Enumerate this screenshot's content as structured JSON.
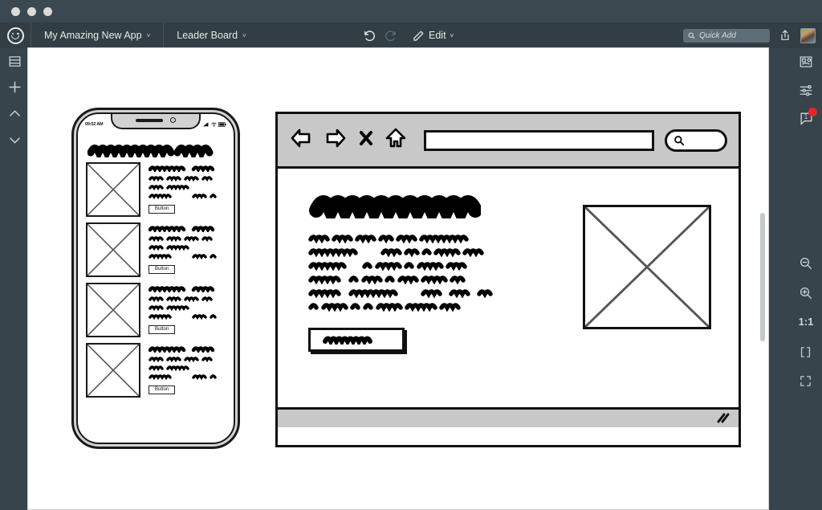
{
  "window": {
    "traffic_lights": [
      "close",
      "minimize",
      "maximize"
    ]
  },
  "menubar": {
    "logo_icon": "smiley-face-logo",
    "items": [
      {
        "label": "My Amazing New App",
        "chevron": "˅"
      },
      {
        "label": "Leader Board",
        "chevron": "˅"
      }
    ],
    "edit_tools": {
      "undo_icon": "undo-arrow-icon",
      "redo_icon": "redo-arrow-icon",
      "pencil_icon": "pencil-icon",
      "edit_label": "Edit",
      "edit_chevron": "˅"
    },
    "right": {
      "search_placeholder": "Quick Add",
      "search_icon": "search-icon",
      "share_icon": "share-upload-icon",
      "avatar_icon": "user-avatar"
    }
  },
  "rail_left": {
    "items": [
      {
        "icon": "layers-pages-icon",
        "name": "pages"
      },
      {
        "icon": "plus-icon",
        "name": "add"
      },
      {
        "icon": "chevron-up-icon",
        "name": "move-up"
      },
      {
        "icon": "chevron-down-icon",
        "name": "move-down"
      }
    ]
  },
  "rail_right": {
    "items": [
      {
        "icon": "properties-panel-icon",
        "name": "inspector"
      },
      {
        "icon": "sliders-icon",
        "name": "settings"
      },
      {
        "icon": "comment-bubble-icon",
        "name": "comments",
        "count": "1",
        "badge": true
      }
    ],
    "zoom": {
      "zoom_out_icon": "zoom-out-icon",
      "zoom_in_icon": "zoom-in-icon",
      "ratio_label": "1:1",
      "fit_width_icon": "fit-width-icon",
      "fit_screen_icon": "fit-screen-icon"
    }
  },
  "colors": {
    "chrome_dark": "#37444c",
    "titlebar": "#3b4850",
    "menubar": "#323d44",
    "canvas": "#ffffff",
    "wireframe_ink": "#111111",
    "wireframe_gray": "#c8c8c8",
    "badge_red": "#e8232a"
  },
  "canvas": {
    "phone": {
      "name": "phone-wireframe",
      "status_time": "09:52 AM",
      "status_icons": [
        "signal-icon",
        "wifi-icon",
        "battery-icon"
      ],
      "notch_items": [
        "speaker-grille",
        "front-camera"
      ],
      "title_scribble": "scribble-heading",
      "rows": [
        {
          "thumb": "image-placeholder",
          "title": "scribble-title",
          "lines": 3,
          "button_label": "Button"
        },
        {
          "thumb": "image-placeholder",
          "title": "scribble-title",
          "lines": 3,
          "button_label": "Button"
        },
        {
          "thumb": "image-placeholder",
          "title": "scribble-title",
          "lines": 3,
          "button_label": "Button"
        },
        {
          "thumb": "image-placeholder",
          "title": "scribble-title",
          "lines": 3,
          "button_label": "Button"
        }
      ]
    },
    "browser": {
      "name": "browser-wireframe",
      "chrome_icons": [
        {
          "icon": "back-arrow-icon",
          "name": "back"
        },
        {
          "icon": "forward-arrow-icon",
          "name": "forward"
        },
        {
          "icon": "stop-x-icon",
          "name": "stop"
        },
        {
          "icon": "home-icon",
          "name": "home"
        }
      ],
      "url_value": "",
      "search_icon": "search-icon",
      "content": {
        "heading_scribble": "scribble-heading",
        "paragraph_lines": 6,
        "image_placeholder": "image-placeholder",
        "button_scribble": "scribble-button-label"
      },
      "status_bar": {
        "resize_grip_icon": "resize-grip-icon"
      }
    }
  }
}
